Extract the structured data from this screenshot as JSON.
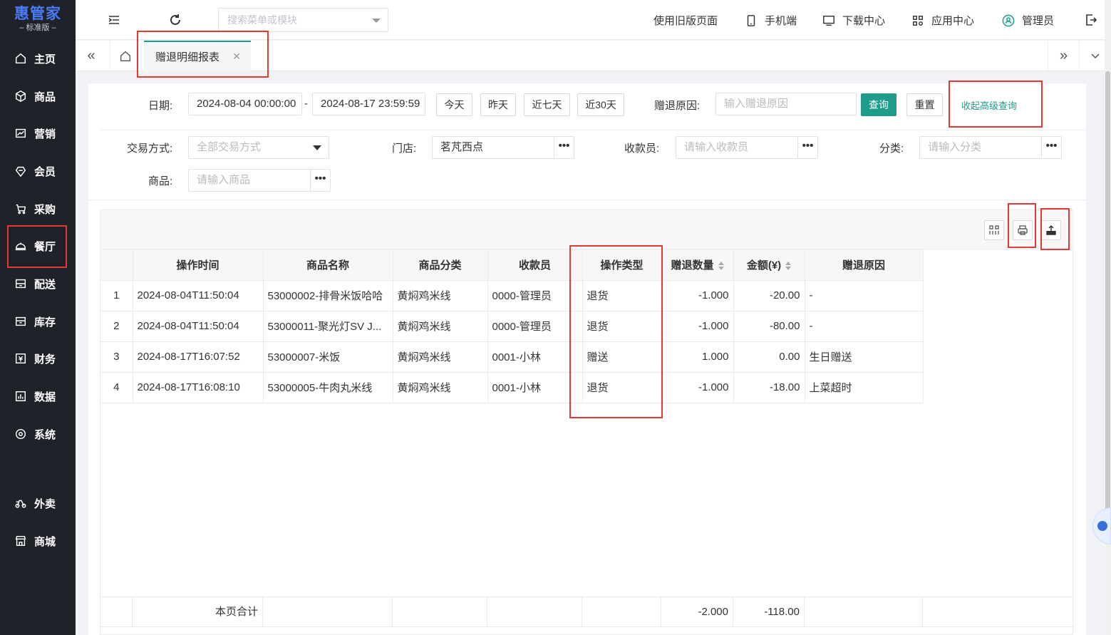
{
  "logo": {
    "main": "惠管家",
    "sub": "标准版"
  },
  "sidebar": {
    "items": [
      {
        "label": "主页",
        "icon": "home-icon"
      },
      {
        "label": "商品",
        "icon": "box-icon"
      },
      {
        "label": "营销",
        "icon": "chart-icon"
      },
      {
        "label": "会员",
        "icon": "diamond-icon"
      },
      {
        "label": "采购",
        "icon": "cart-icon"
      },
      {
        "label": "餐厅",
        "icon": "cloche-icon"
      },
      {
        "label": "配送",
        "icon": "truck-icon"
      },
      {
        "label": "库存",
        "icon": "warehouse-icon"
      },
      {
        "label": "财务",
        "icon": "finance-icon"
      },
      {
        "label": "数据",
        "icon": "data-icon"
      },
      {
        "label": "系统",
        "icon": "settings-icon"
      },
      {
        "label": "外卖",
        "icon": "scooter-icon"
      },
      {
        "label": "商城",
        "icon": "store-icon"
      }
    ]
  },
  "header": {
    "search_placeholder": "搜索菜单或模块",
    "links": {
      "old_page": "使用旧版页面",
      "mobile": "手机端",
      "download": "下载中心",
      "apps": "应用中心",
      "user": "管理员"
    }
  },
  "tabs": {
    "active_label": "赠退明细报表"
  },
  "filters": {
    "date_label": "日期:",
    "date_start": "2024-08-04 00:00:00",
    "date_sep": "-",
    "date_end": "2024-08-17 23:59:59",
    "quick": {
      "today": "今天",
      "yesterday": "昨天",
      "last7": "近七天",
      "last30": "近30天"
    },
    "reason_label": "赠退原因:",
    "reason_placeholder": "输入赠退原因",
    "query": "查询",
    "reset": "重置",
    "collapse": "收起高级查询",
    "trade_label": "交易方式:",
    "trade_value": "全部交易方式",
    "store_label": "门店:",
    "store_value": "茗芃西点",
    "cashier_label": "收款员:",
    "cashier_placeholder": "请输入收款员",
    "category_label": "分类:",
    "category_placeholder": "请输入分类",
    "product_label": "商品:",
    "product_placeholder": "请输入商品",
    "dots": "•••"
  },
  "table": {
    "columns": [
      "",
      "操作时间",
      "商品名称",
      "商品分类",
      "收款员",
      "操作类型",
      "赠退数量",
      "金额(¥)",
      "赠退原因"
    ],
    "rows": [
      [
        "1",
        "2024-08-04T11:50:04",
        "53000002-排骨米饭哈哈",
        "黄焖鸡米线",
        "0000-管理员",
        "退货",
        "-1.000",
        "-20.00",
        "-"
      ],
      [
        "2",
        "2024-08-04T11:50:04",
        "53000011-聚光灯SV J...",
        "黄焖鸡米线",
        "0000-管理员",
        "退货",
        "-1.000",
        "-80.00",
        "-"
      ],
      [
        "3",
        "2024-08-17T16:07:52",
        "53000007-米饭",
        "黄焖鸡米线",
        "0001-小林",
        "赠送",
        "1.000",
        "0.00",
        "生日赠送"
      ],
      [
        "4",
        "2024-08-17T16:08:10",
        "53000005-牛肉丸米线",
        "黄焖鸡米线",
        "0001-小林",
        "退货",
        "-1.000",
        "-18.00",
        "上菜超时"
      ]
    ],
    "footer": {
      "label": "本页合计",
      "qty": "-2.000",
      "amount": "-118.00"
    }
  },
  "colors": {
    "accent": "#1e9b8a",
    "sidebar_bg": "#1f2228",
    "annotation": "#e53935",
    "logo": "#4a7cf7"
  }
}
